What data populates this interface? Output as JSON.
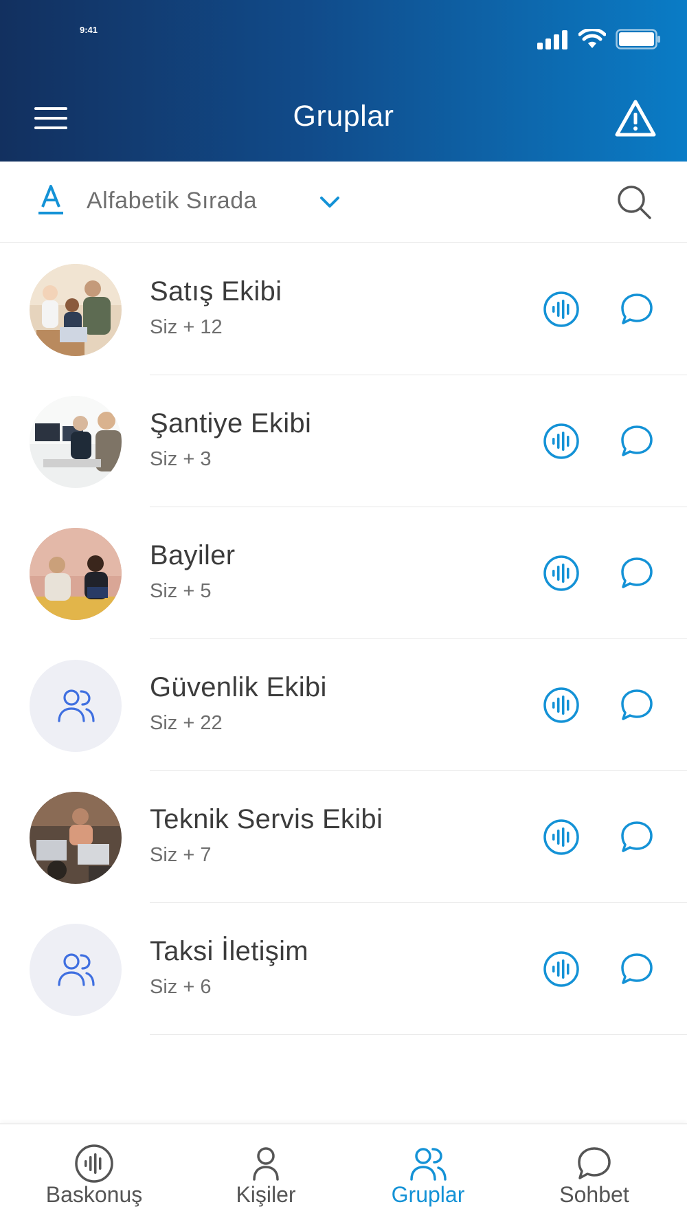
{
  "status_bar": {
    "time": "9:41"
  },
  "header": {
    "title": "Gruplar"
  },
  "sort": {
    "label": "Alfabetik Sırada"
  },
  "groups": [
    {
      "name": "Satış Ekibi",
      "members": "Siz + 12",
      "avatar": "photo-team-laptop"
    },
    {
      "name": "Şantiye Ekibi",
      "members": "Siz + 3",
      "avatar": "photo-office-monitors"
    },
    {
      "name": "Bayiler",
      "members": "Siz + 5",
      "avatar": "photo-meeting-brick-wall"
    },
    {
      "name": "Güvenlik Ekibi",
      "members": "Siz + 22",
      "avatar": "group-icon"
    },
    {
      "name": "Teknik Servis Ekibi",
      "members": "Siz + 7",
      "avatar": "photo-workspace-laptops"
    },
    {
      "name": "Taksi İletişim",
      "members": "Siz + 6",
      "avatar": "group-icon"
    }
  ],
  "bottom_nav": [
    {
      "label": "Baskonuş",
      "icon": "ptt-icon",
      "active": false
    },
    {
      "label": "Kişiler",
      "icon": "person-icon",
      "active": false
    },
    {
      "label": "Gruplar",
      "icon": "group-icon",
      "active": true
    },
    {
      "label": "Sohbet",
      "icon": "chat-icon",
      "active": false
    }
  ],
  "colors": {
    "accent": "#1492d6",
    "header_start": "#12305f",
    "header_end": "#0a7cc6",
    "group_icon": "#3f6fe0"
  }
}
